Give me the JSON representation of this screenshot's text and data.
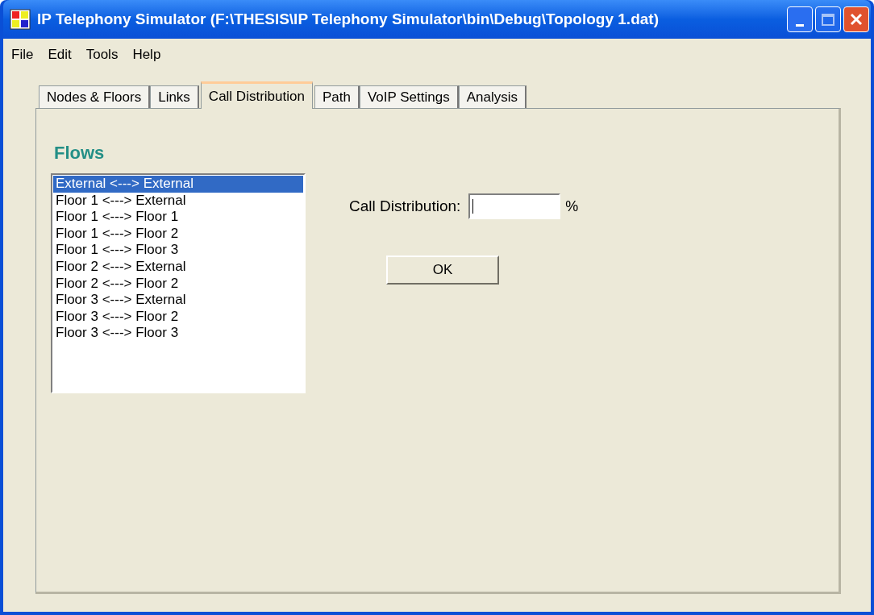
{
  "window": {
    "title": "IP Telephony Simulator (F:\\THESIS\\IP Telephony Simulator\\bin\\Debug\\Topology 1.dat)"
  },
  "menu": [
    "File",
    "Edit",
    "Tools",
    "Help"
  ],
  "tabs": [
    {
      "label": "Nodes & Floors",
      "selected": false
    },
    {
      "label": "Links",
      "selected": false
    },
    {
      "label": "Call Distribution",
      "selected": true
    },
    {
      "label": "Path",
      "selected": false
    },
    {
      "label": "VoIP Settings",
      "selected": false
    },
    {
      "label": "Analysis",
      "selected": false
    }
  ],
  "flows": {
    "heading": "Flows",
    "items": [
      {
        "label": "External <---> External",
        "selected": true
      },
      {
        "label": "Floor 1 <---> External",
        "selected": false
      },
      {
        "label": "Floor 1 <---> Floor 1",
        "selected": false
      },
      {
        "label": "Floor 1 <---> Floor 2",
        "selected": false
      },
      {
        "label": "Floor 1 <---> Floor 3",
        "selected": false
      },
      {
        "label": "Floor 2 <---> External",
        "selected": false
      },
      {
        "label": "Floor 2 <---> Floor 2",
        "selected": false
      },
      {
        "label": "Floor 3 <---> External",
        "selected": false
      },
      {
        "label": "Floor 3 <---> Floor 2",
        "selected": false
      },
      {
        "label": "Floor 3 <---> Floor 3",
        "selected": false
      }
    ]
  },
  "call_distribution": {
    "label": "Call Distribution:",
    "unit": "%"
  },
  "ok_button": "OK"
}
